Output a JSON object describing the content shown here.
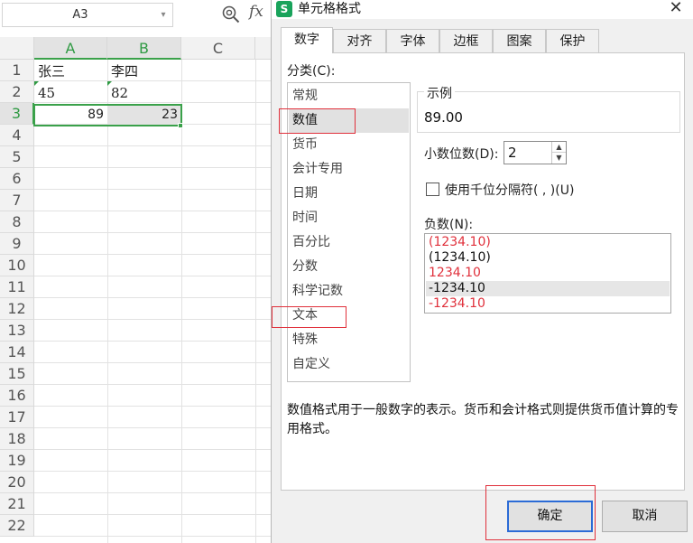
{
  "namebox": {
    "value": "A3"
  },
  "sheet": {
    "columns": [
      "A",
      "B",
      "C"
    ],
    "rows": [
      "1",
      "2",
      "3",
      "4",
      "5",
      "6",
      "7",
      "8",
      "9",
      "10",
      "11",
      "12",
      "13",
      "14",
      "15",
      "16",
      "17",
      "18",
      "19",
      "20",
      "21",
      "22"
    ],
    "cells": {
      "a1": "张三",
      "b1": "李四",
      "a2": "45",
      "b2": "82",
      "a3": "89",
      "b3": "23"
    }
  },
  "dialog": {
    "title": "单元格格式",
    "close_glyph": "✕",
    "app_icon_glyph": "S",
    "tabs": [
      "数字",
      "对齐",
      "字体",
      "边框",
      "图案",
      "保护"
    ],
    "category_label": "分类(C):",
    "categories": [
      "常规",
      "数值",
      "货币",
      "会计专用",
      "日期",
      "时间",
      "百分比",
      "分数",
      "科学记数",
      "文本",
      "特殊",
      "自定义"
    ],
    "sample_label": "示例",
    "sample_value": "89.00",
    "decimal_label": "小数位数(D):",
    "decimal_value": "2",
    "separator_label": "使用千位分隔符( , )(U)",
    "negative_label": "负数(N):",
    "negatives": [
      "(1234.10)",
      "(1234.10)",
      "1234.10",
      "-1234.10",
      "-1234.10"
    ],
    "description": "数值格式用于一般数字的表示。货币和会计格式则提供货币值计算的专用格式。",
    "ok_label": "确定",
    "cancel_label": "取消"
  },
  "colors": {
    "accent_green": "#3aa14a",
    "negative_red": "#e0303b",
    "highlight_red": "#e0303b",
    "focus_blue": "#2b6bd6"
  }
}
